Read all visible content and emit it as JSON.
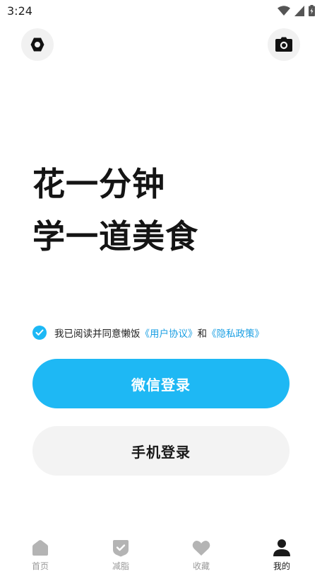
{
  "status_bar": {
    "time": "3:24"
  },
  "headline": {
    "line1": "花一分钟",
    "line2": "学一道美食"
  },
  "agreement": {
    "prefix": "我已阅读并同意懒饭",
    "user_agreement": "《用户协议》",
    "conjunction": "和",
    "privacy_policy": "《隐私政策》"
  },
  "buttons": {
    "wechat_login": "微信登录",
    "phone_login": "手机登录"
  },
  "tabbar": {
    "items": [
      {
        "label": "首页",
        "icon": "home-icon"
      },
      {
        "label": "减脂",
        "icon": "shield-check-icon"
      },
      {
        "label": "收藏",
        "icon": "heart-icon"
      },
      {
        "label": "我的",
        "icon": "person-icon"
      }
    ],
    "active_index": 3
  },
  "colors": {
    "accent": "#1eb8f4",
    "link": "#1a9fe3",
    "tab_inactive": "#b4b4b4",
    "tab_active": "#1a1a1a"
  }
}
